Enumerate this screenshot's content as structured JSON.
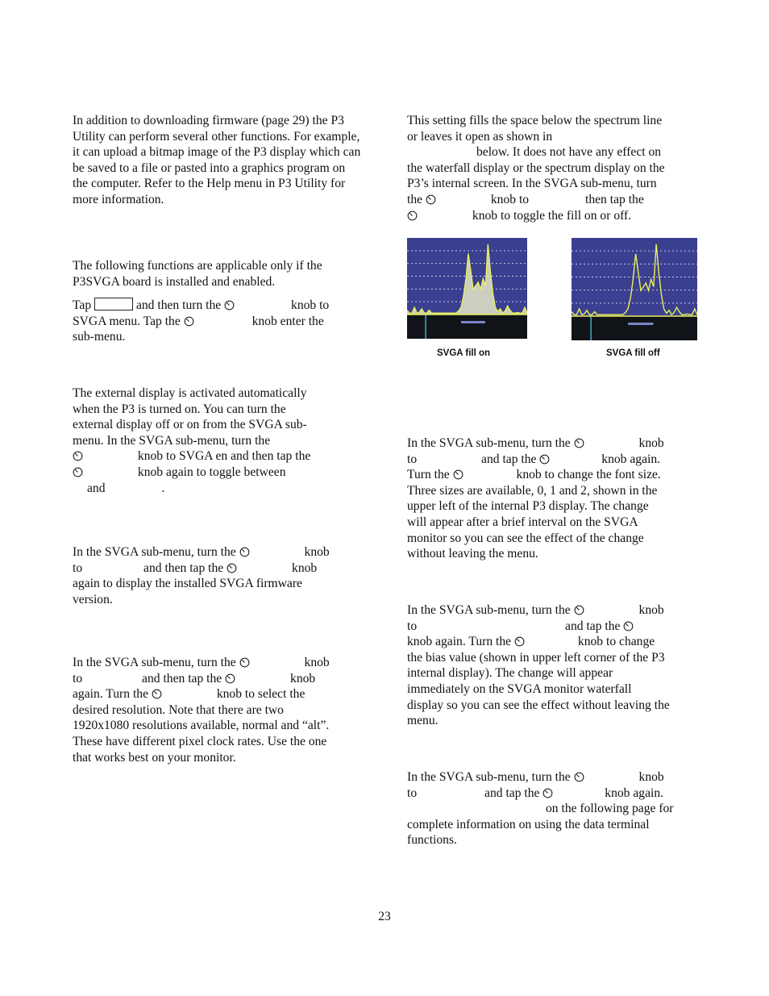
{
  "page_number": "23",
  "left_column": {
    "utility_paragraph": "In addition to downloading firmware (page 29) the P3 Utility can perform several other functions. For example, it can upload a bitmap image of the P3 display which can be saved to a file or pasted into a graphics program on the computer. Refer to the Help menu in P3 Utility for more information.",
    "svga_intro": "The following functions are applicable only if the P3SVGA board is installed and enabled.",
    "svga_menu": {
      "tap": "Tap",
      "p1": "and then turn the",
      "p2": "knob to",
      "p3": "SVGA menu. Tap the",
      "p4": "knob enter the",
      "p5": "sub-menu."
    },
    "external_display": {
      "l1": "The external display is activated automatically",
      "l2": "when the P3 is turned on. You can turn the",
      "l3": "external display off or on from the SVGA sub-",
      "l4": "menu. In the SVGA sub-menu, turn the",
      "l5": "knob to SVGA en and then tap the",
      "l6": "knob again to toggle between",
      "l7a": "and",
      "l7b": "."
    },
    "firmware_version": {
      "l1": "In the SVGA sub-menu, turn the",
      "l1b": "knob",
      "l2a": "to",
      "l2b": "and then tap the",
      "l2c": "knob",
      "l3": "again to display the installed SVGA firmware",
      "l4": "version."
    },
    "resolution": {
      "l1": "In the SVGA sub-menu, turn the",
      "l1b": "knob",
      "l2a": "to",
      "l2b": "and then tap the",
      "l2c": "knob",
      "l3a": "again. Turn the",
      "l3b": "knob to select the",
      "l4": "desired resolution. Note that there are two",
      "l5": "1920x1080 resolutions available, normal and “alt”.",
      "l6": "These have different pixel clock rates. Use the one",
      "l7": "that works best on your monitor."
    }
  },
  "right_column": {
    "fill": {
      "l1": "This setting fills the space below the spectrum line",
      "l2": "or leaves it open as shown in",
      "l3": "below. It does not have any effect on",
      "l4": "the waterfall display or the spectrum display on the",
      "l5": "P3’s internal screen. In the SVGA sub-menu, turn",
      "l6a": "the",
      "l6b": "knob to",
      "l6c": "then tap the",
      "l7": "knob to toggle the fill on or off."
    },
    "figures": [
      {
        "caption": "SVGA fill on",
        "filled": true
      },
      {
        "caption": "SVGA fill off",
        "filled": false
      }
    ],
    "font_size": {
      "l1": "In the SVGA sub-menu, turn the",
      "l1b": "knob",
      "l2a": "to",
      "l2b": "and tap the",
      "l2c": "knob again.",
      "l3a": "Turn the",
      "l3b": "knob to change the font size.",
      "l4": "Three sizes are available, 0, 1 and 2, shown in the",
      "l5": "upper left of the internal P3 display. The change",
      "l6": "will appear after a brief interval on the SVGA",
      "l7": "monitor so you can see the effect of the change",
      "l8": "without leaving the menu."
    },
    "bias": {
      "l1": "In the SVGA sub-menu, turn the",
      "l1b": "knob",
      "l2a": "to",
      "l2b": "and tap the",
      "l3a": "knob again. Turn the",
      "l3b": "knob to change",
      "l4": "the bias value (shown in upper left corner of the P3",
      "l5": "internal display). The change will appear",
      "l6": "immediately on the SVGA monitor waterfall",
      "l7": "display so you can see the effect without leaving the",
      "l8": "menu."
    },
    "terminal": {
      "l1": "In the SVGA sub-menu, turn the",
      "l1b": "knob",
      "l2a": "to",
      "l2b": "and tap the",
      "l2c": "knob again.",
      "l3": "on the following page for",
      "l4": "complete information on using the data terminal",
      "l5": "functions."
    }
  },
  "colors": {
    "spectrum_bg": "#3a3f8f",
    "trace": "#e8f05a",
    "fill": "#e6e8c8",
    "grid": "#c8c8e8",
    "waterfall": "#101418"
  }
}
